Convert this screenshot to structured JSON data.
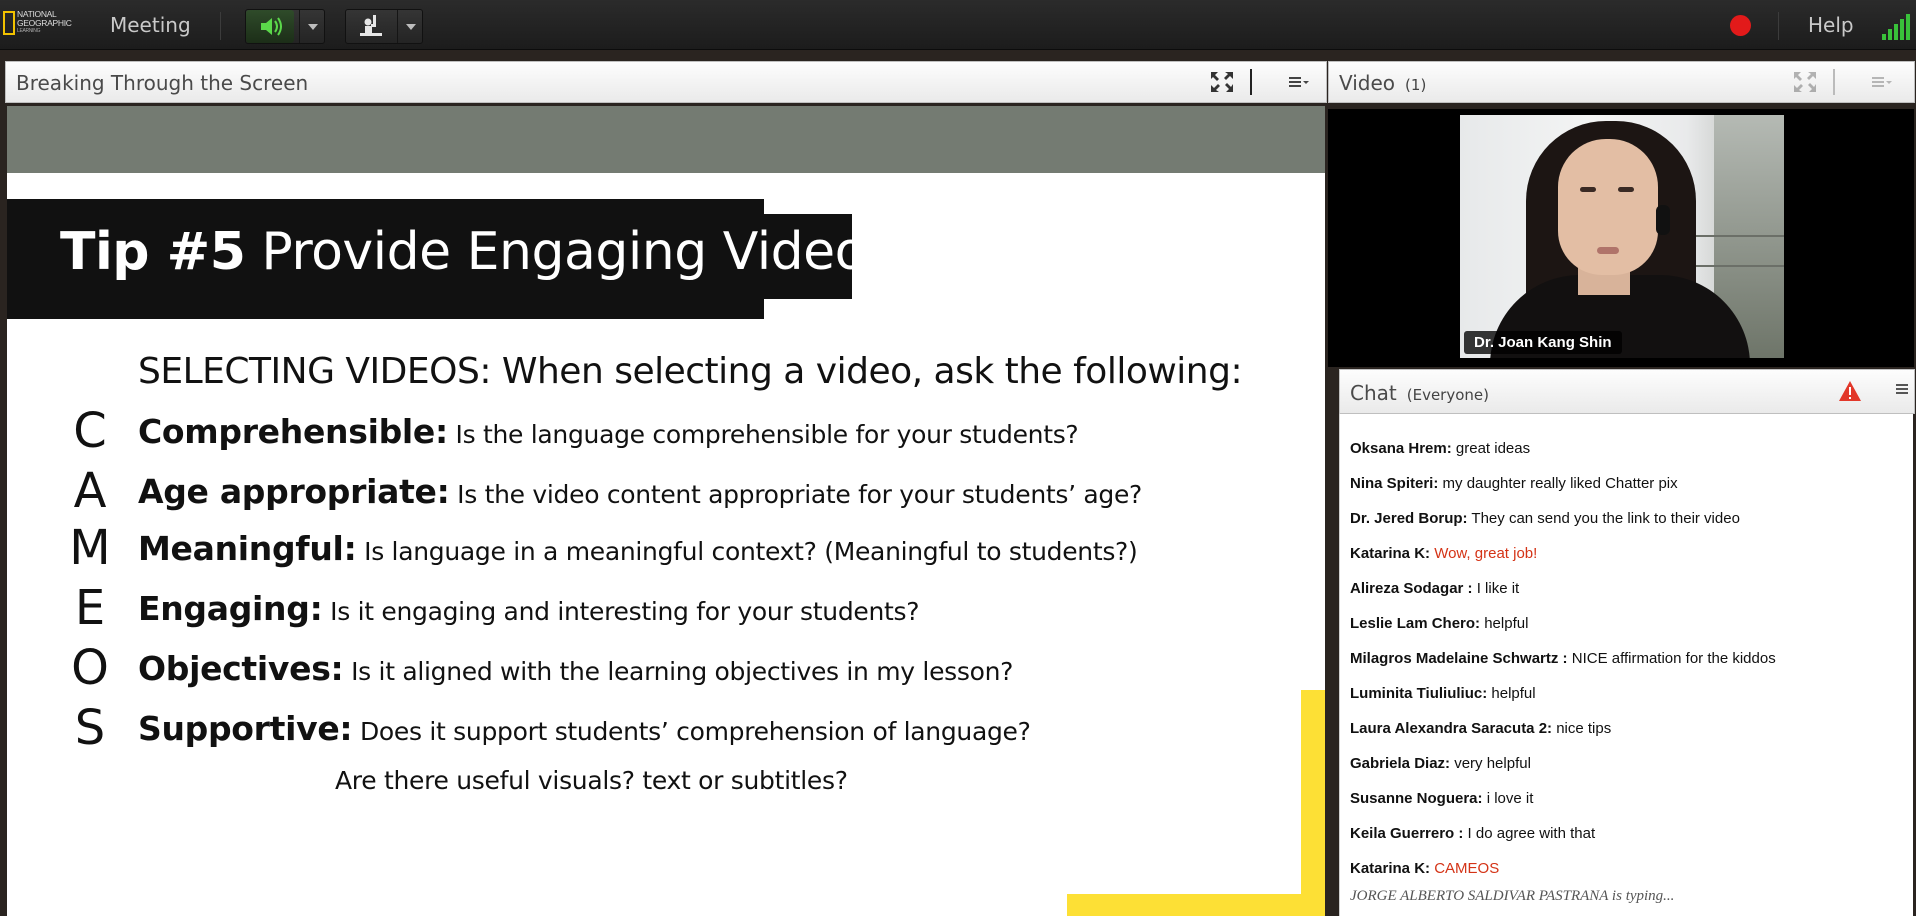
{
  "topbar": {
    "logo_lines": [
      "NATIONAL",
      "GEOGRAPHIC",
      "LEARNING"
    ],
    "menu_meeting": "Meeting",
    "menu_help": "Help",
    "audio_icon": "speaker-icon",
    "raise_hand_icon": "raise-hand-icon",
    "record_color": "#e21a1a",
    "signal_color": "#39c13a"
  },
  "share_pod": {
    "title": "Breaking Through the Screen"
  },
  "slide": {
    "title_bold": "Tip #5",
    "title_rest": " Provide Engaging Videos",
    "subheading": "SELECTING VIDEOS: When selecting a video, ask the following:",
    "items": [
      {
        "letter": "C",
        "key": "Comprehensible:",
        "text": " Is the language comprehensible for your students?"
      },
      {
        "letter": "A",
        "key": "Age appropriate:",
        "text": " Is the video content appropriate for your students’ age?"
      },
      {
        "letter": "M",
        "key": "Meaningful:",
        "text": " Is language in a meaningful context? (Meaningful to students?)"
      },
      {
        "letter": "E",
        "key": "Engaging:",
        "text": " Is it engaging and interesting for your students?"
      },
      {
        "letter": "O",
        "key": "Objectives:",
        "text": " Is it aligned with the learning objectives in my lesson?"
      },
      {
        "letter": "S",
        "key": "Supportive:",
        "text": " Does it support students’ comprehension of language?"
      }
    ],
    "continuation": "Are there useful visuals? text or subtitles?",
    "accent_color": "#fde035",
    "band_color": "#747b72"
  },
  "video_pod": {
    "title": "Video",
    "count": "(1)",
    "presenter_name": "Dr. Joan Kang Shin"
  },
  "chat_pod": {
    "title": "Chat",
    "audience": "(Everyone)",
    "messages": [
      {
        "name": "Oksana Hrem:",
        "text": "  great ideas",
        "red": false
      },
      {
        "name": "Nina Spiteri:",
        "text": " my daughter really liked Chatter pix",
        "red": false
      },
      {
        "name": "Dr. Jered Borup:",
        "text": " They can send you the link to their video",
        "red": false
      },
      {
        "name": "Katarina K:",
        "text": " Wow, great job!",
        "red": true
      },
      {
        "name": "Alireza  Sodagar :",
        "text": " I like it",
        "red": false
      },
      {
        "name": "Leslie Lam Chero:",
        "text": " helpful",
        "red": false
      },
      {
        "name": "Milagros Madelaine  Schwartz :",
        "text": " NICE affirmation for the kiddos",
        "red": false
      },
      {
        "name": "Luminita Tiuliuliuc:",
        "text": " helpful",
        "red": false
      },
      {
        "name": "Laura Alexandra Saracuta 2:",
        "text": " nice tips",
        "red": false
      },
      {
        "name": "Gabriela  Diaz:",
        "text": " very helpful",
        "red": false
      },
      {
        "name": "Susanne Noguera:",
        "text": " i love it",
        "red": false
      },
      {
        "name": "Keila Guerrero :",
        "text": " I do agree with that",
        "red": false
      },
      {
        "name": "Katarina K:",
        "text": " CAMEOS",
        "red": true
      }
    ],
    "typing": "JORGE ALBERTO SALDIVAR PASTRANA is typing...",
    "alert_color": "#e2382a"
  }
}
